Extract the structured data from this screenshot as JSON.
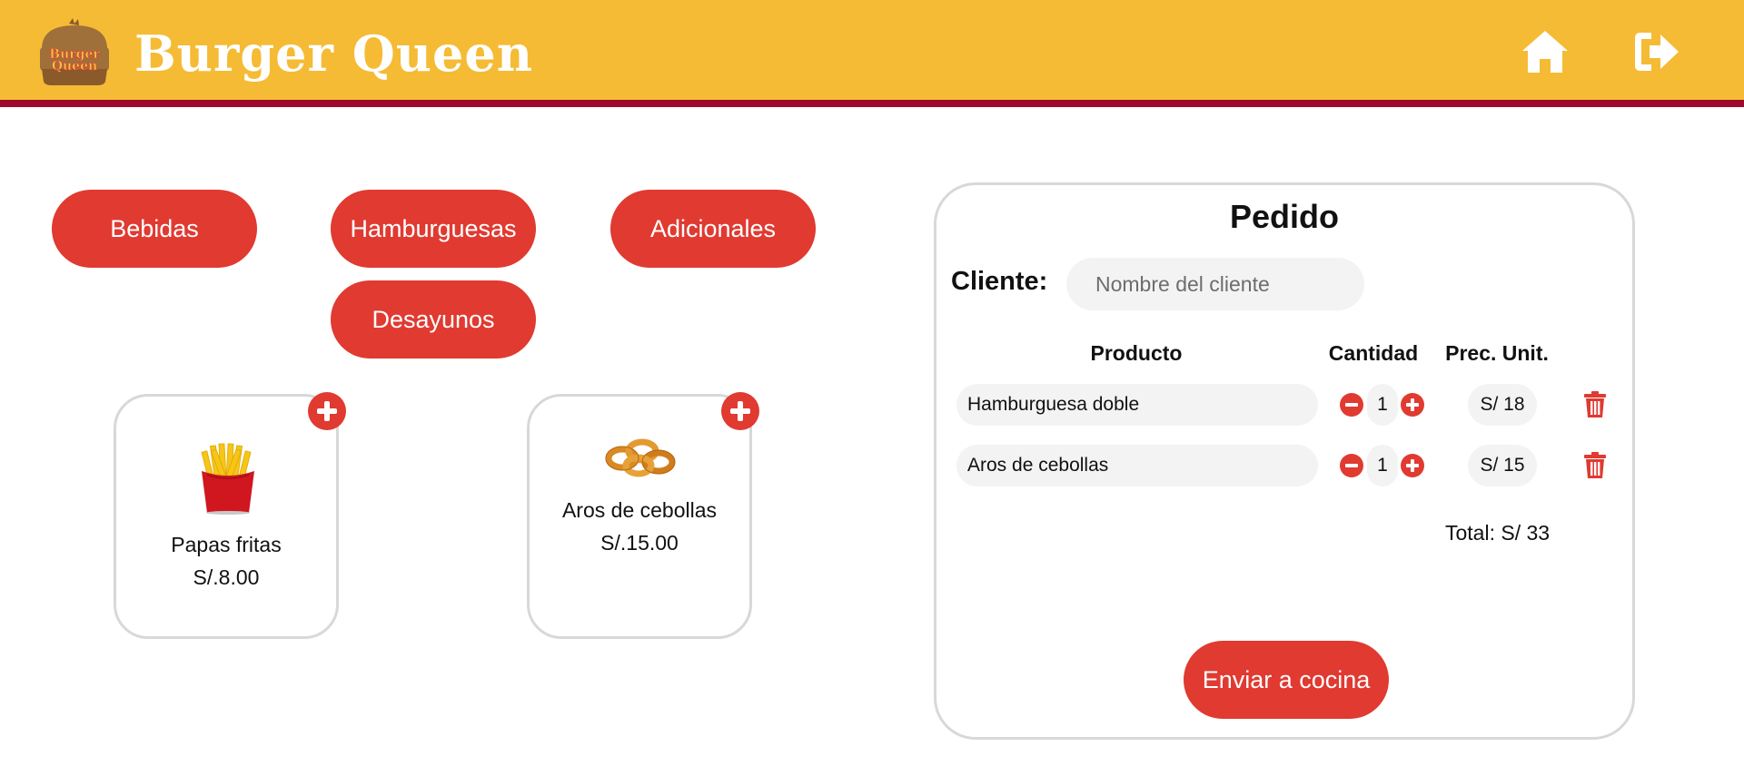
{
  "header": {
    "brand": "Burger Queen",
    "logo_text": [
      "Burger",
      "Queen"
    ],
    "icons": [
      "home-icon",
      "logout-icon"
    ],
    "bg_color": "#f5bb35",
    "border_color": "#9e0a2e"
  },
  "categories": [
    {
      "label": "Bebidas"
    },
    {
      "label": "Hamburguesas"
    },
    {
      "label": "Adicionales"
    },
    {
      "label": "Desayunos"
    }
  ],
  "products": [
    {
      "name": "Papas fritas",
      "price": "S/.8.00",
      "icon": "fries-image"
    },
    {
      "name": "Aros de cebollas",
      "price": "S/.15.00",
      "icon": "onion-rings-image"
    }
  ],
  "order": {
    "title": "Pedido",
    "client_label": "Cliente:",
    "client_placeholder": "Nombre del cliente",
    "client_value": "",
    "columns": [
      "Producto",
      "Cantidad",
      "Prec. Unit."
    ],
    "items": [
      {
        "name": "Hamburguesa doble",
        "qty": "1",
        "price": "S/ 18"
      },
      {
        "name": "Aros de cebollas",
        "qty": "1",
        "price": "S/ 15"
      }
    ],
    "total": "Total: S/ 33",
    "send_label": "Enviar a cocina"
  },
  "colors": {
    "accent": "#e03a31",
    "pill_bg": "#f3f3f3",
    "border": "#d8d8d8"
  }
}
